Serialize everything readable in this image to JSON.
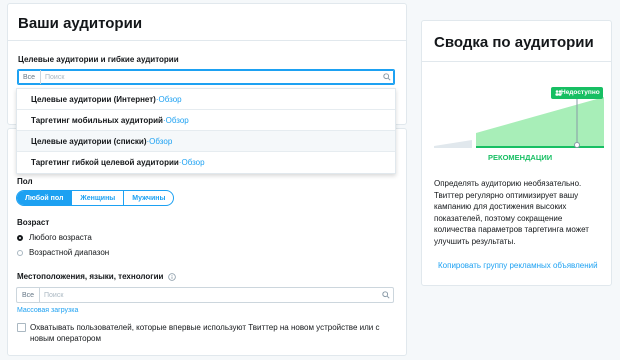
{
  "audiences": {
    "title": "Ваши аудитории",
    "section_label": "Целевые аудитории и гибкие аудитории",
    "prefix": "Все",
    "placeholder": "Поиск",
    "dropdown": [
      {
        "name": "Целевые аудитории (Интернет)",
        "link": "Обзор"
      },
      {
        "name": "Таргетинг мобильных аудиторий",
        "link": "Обзор"
      },
      {
        "name": "Целевые аудитории (списки)",
        "link": "Обзор"
      },
      {
        "name": "Таргетинг гибкой целевой аудитории",
        "link": "Обзор"
      }
    ],
    "separator": " · "
  },
  "gender": {
    "label": "Пол",
    "options": [
      "Любой пол",
      "Женщины",
      "Мужчины"
    ],
    "selected": "Любой пол"
  },
  "age": {
    "label": "Возраст",
    "options": [
      "Любого возраста",
      "Возрастной диапазон"
    ],
    "selected": "Любого возраста"
  },
  "locations": {
    "label": "Местоположения, языки, технологии",
    "prefix": "Все",
    "placeholder": "Поиск",
    "bulk_upload": "Массовая загрузка",
    "checkbox_text": "Охватывать пользователей, которые впервые используют Твиттер на новом устройстве или с новым оператором"
  },
  "summary": {
    "title": "Сводка по аудитории",
    "badge": "Недоступно",
    "recommended": "РЕКОМЕНДАЦИИ",
    "description": "Определять аудиторию необязательно. Твиттер регулярно оптимизирует вашу кампанию для достижения высоких показателей, поэтому сокращение количества параметров таргетинга может улучшить результаты.",
    "copy_link": "Копировать группу рекламных объявлений"
  },
  "colors": {
    "accent": "#1da1f2",
    "green": "#17bf63",
    "green_light": "#a8eeb8"
  }
}
